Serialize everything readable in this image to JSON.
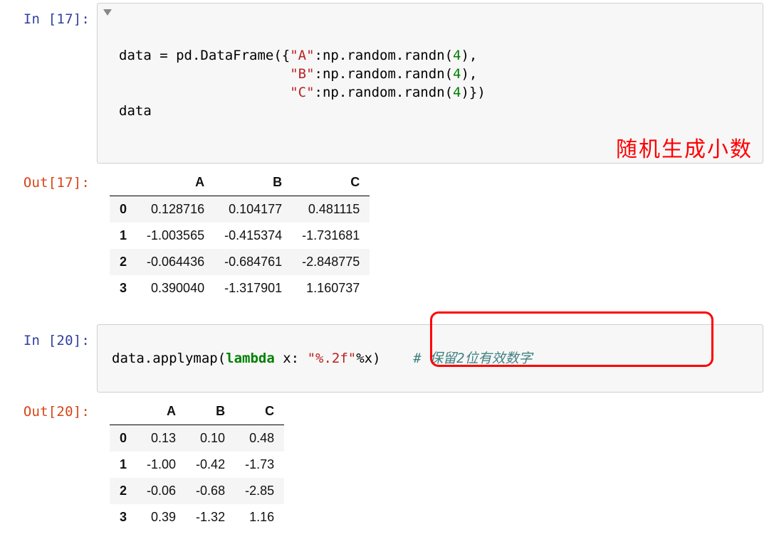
{
  "cells": {
    "in17": {
      "prompt": "In [17]:",
      "code_lines": [
        {
          "pre": "data = pd.DataFrame({",
          "str": "\"A\"",
          "mid": ":np.random.randn(",
          "num": "4",
          "post": "),"
        },
        {
          "pre": "                     ",
          "str": "\"B\"",
          "mid": ":np.random.randn(",
          "num": "4",
          "post": "),"
        },
        {
          "pre": "                     ",
          "str": "\"C\"",
          "mid": ":np.random.randn(",
          "num": "4",
          "post": ")})"
        },
        {
          "plain": "data"
        }
      ],
      "annotation": "随机生成小数"
    },
    "out17": {
      "prompt": "Out[17]:",
      "columns": [
        "A",
        "B",
        "C"
      ],
      "index": [
        "0",
        "1",
        "2",
        "3"
      ],
      "rows": [
        [
          "0.128716",
          "0.104177",
          "0.481115"
        ],
        [
          "-1.003565",
          "-0.415374",
          "-1.731681"
        ],
        [
          "-0.064436",
          "-0.684761",
          "-2.848775"
        ],
        [
          "0.390040",
          "-1.317901",
          "1.160737"
        ]
      ]
    },
    "in20": {
      "prompt": "In [20]:",
      "code": {
        "pre": "data.applymap(",
        "kw": "lambda",
        "mid": " x: ",
        "str": "\"%.2f\"",
        "post": "%x)",
        "cmt": "# 保留2位有效数字"
      }
    },
    "out20": {
      "prompt": "Out[20]:",
      "columns": [
        "A",
        "B",
        "C"
      ],
      "index": [
        "0",
        "1",
        "2",
        "3"
      ],
      "rows": [
        [
          "0.13",
          "0.10",
          "0.48"
        ],
        [
          "-1.00",
          "-0.42",
          "-1.73"
        ],
        [
          "-0.06",
          "-0.68",
          "-2.85"
        ],
        [
          "0.39",
          "-1.32",
          "1.16"
        ]
      ]
    }
  }
}
